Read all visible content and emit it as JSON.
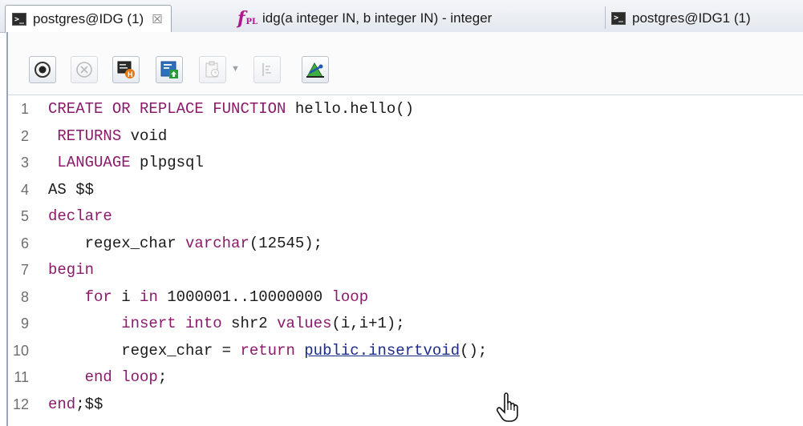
{
  "tabs": [
    {
      "label": "postgres@IDG (1)",
      "icon": "terminal-icon",
      "active": true,
      "close": "☒"
    },
    {
      "label": "idg(a integer IN, b integer IN) - integer",
      "icon": "plpgsql-function-icon",
      "icon_text": "f",
      "icon_sub": "PL",
      "active": false
    },
    {
      "label": "postgres@IDG1 (1)",
      "icon": "terminal-icon",
      "active": false
    }
  ],
  "toolbar": {
    "buttons": [
      "execute-icon",
      "cancel-icon",
      "explain-icon",
      "compile-icon",
      "history-icon",
      "dropdown-arrow-icon",
      "format-icon",
      "chart-icon"
    ]
  },
  "code": {
    "lines": [
      {
        "n": "1",
        "parts": [
          {
            "t": "CREATE OR REPLACE FUNCTION",
            "c": "kw"
          },
          {
            "t": " hello.hello()",
            "c": ""
          }
        ]
      },
      {
        "n": "2",
        "parts": [
          {
            "t": " RETURNS",
            "c": "kw"
          },
          {
            "t": " void",
            "c": ""
          }
        ]
      },
      {
        "n": "3",
        "parts": [
          {
            "t": " LANGUAGE",
            "c": "kw"
          },
          {
            "t": " plpgsql",
            "c": ""
          }
        ]
      },
      {
        "n": "4",
        "parts": [
          {
            "t": "AS $$",
            "c": ""
          }
        ]
      },
      {
        "n": "5",
        "parts": [
          {
            "t": "declare",
            "c": "kw"
          }
        ]
      },
      {
        "n": "6",
        "parts": [
          {
            "t": "    regex_char ",
            "c": ""
          },
          {
            "t": "varchar",
            "c": "kw"
          },
          {
            "t": "(12545);",
            "c": ""
          }
        ]
      },
      {
        "n": "7",
        "parts": [
          {
            "t": "begin",
            "c": "kw"
          }
        ]
      },
      {
        "n": "8",
        "parts": [
          {
            "t": "    ",
            "c": ""
          },
          {
            "t": "for",
            "c": "kw"
          },
          {
            "t": " i ",
            "c": ""
          },
          {
            "t": "in",
            "c": "kw"
          },
          {
            "t": " 1000001..10000000 ",
            "c": ""
          },
          {
            "t": "loop",
            "c": "kw"
          }
        ]
      },
      {
        "n": "9",
        "parts": [
          {
            "t": "        ",
            "c": ""
          },
          {
            "t": "insert into",
            "c": "kw"
          },
          {
            "t": " shr2 ",
            "c": ""
          },
          {
            "t": "values",
            "c": "kw"
          },
          {
            "t": "(i,i+1);",
            "c": ""
          }
        ]
      },
      {
        "n": "10",
        "parts": [
          {
            "t": "        regex_char = ",
            "c": ""
          },
          {
            "t": "return",
            "c": "kw"
          },
          {
            "t": " ",
            "c": ""
          },
          {
            "t": "public.insertvoid",
            "c": "lnk"
          },
          {
            "t": "();",
            "c": ""
          }
        ]
      },
      {
        "n": "11",
        "parts": [
          {
            "t": "    ",
            "c": ""
          },
          {
            "t": "end loop",
            "c": "kw"
          },
          {
            "t": ";",
            "c": ""
          }
        ]
      },
      {
        "n": "12",
        "parts": [
          {
            "t": "end",
            "c": "kw"
          },
          {
            "t": ";$$",
            "c": ""
          }
        ]
      }
    ]
  },
  "colors": {
    "keyword": "#8b1a6b",
    "link": "#1b2a8a",
    "line_number": "#6e6e6e"
  }
}
